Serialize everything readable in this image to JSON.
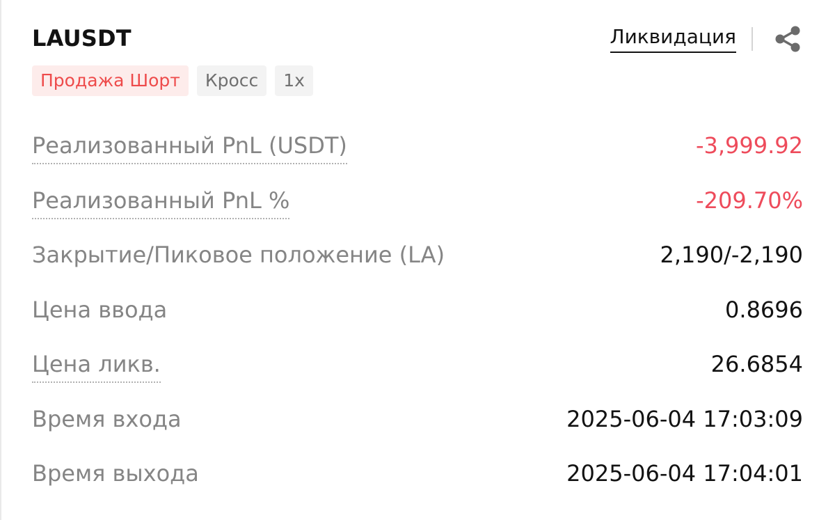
{
  "colors": {
    "negative": "#ee4b5b",
    "sell_tag_bg": "#fdeceb",
    "sell_tag_text": "#ee4b4b",
    "neutral_tag_bg": "#f3f3f3",
    "label_gray": "#858585",
    "text_dark": "#121212"
  },
  "header": {
    "symbol": "LAUSDT",
    "liquidation_label": "Ликвидация",
    "share_icon": "share-icon"
  },
  "tags": [
    {
      "label": "Продажа Шорт",
      "kind": "sell"
    },
    {
      "label": "Кросс",
      "kind": "neutral"
    },
    {
      "label": "1x",
      "kind": "neutral"
    }
  ],
  "rows": [
    {
      "label": "Реализованный PnL (USDT)",
      "value": "-3,999.92"
    },
    {
      "label": "Реализованный PnL %",
      "value": "-209.70%"
    },
    {
      "label": "Закрытие/Пиковое положение (LA)",
      "value": "2,190/-2,190"
    },
    {
      "label": "Цена ввода",
      "value": "0.8696"
    },
    {
      "label": "Цена ликв.",
      "value": "26.6854"
    },
    {
      "label": "Время входа",
      "value": "2025-06-04 17:03:09"
    },
    {
      "label": "Время выхода",
      "value": "2025-06-04 17:04:01"
    }
  ]
}
